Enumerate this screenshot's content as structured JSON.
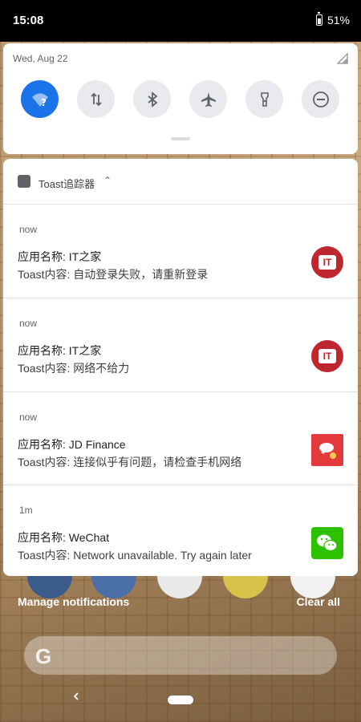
{
  "status_bar": {
    "time": "15:08",
    "battery": "51%"
  },
  "quick_settings": {
    "date": "Wed, Aug 22",
    "tiles": [
      {
        "name": "wifi",
        "icon": "wifi-icon",
        "active": true
      },
      {
        "name": "data",
        "icon": "data-transfer-icon",
        "active": false
      },
      {
        "name": "bluetooth",
        "icon": "bluetooth-icon",
        "active": false
      },
      {
        "name": "airplane",
        "icon": "airplane-icon",
        "active": false
      },
      {
        "name": "flashlight",
        "icon": "flashlight-icon",
        "active": false
      },
      {
        "name": "dnd",
        "icon": "do-not-disturb-icon",
        "active": false
      }
    ]
  },
  "notifications": {
    "group_title": "Toast追踪器",
    "items": [
      {
        "time": "now",
        "title": "应用名称: IT之家",
        "text": "Toast内容: 自动登录失败，请重新登录",
        "icon": "ithome-icon",
        "icon_label": "IT"
      },
      {
        "time": "now",
        "title": "应用名称: IT之家",
        "text": "Toast内容: 网络不给力",
        "icon": "ithome-icon",
        "icon_label": "IT"
      },
      {
        "time": "now",
        "title": "应用名称: JD Finance",
        "text": "Toast内容: 连接似乎有问题，请检查手机网络",
        "icon": "jd-finance-icon",
        "icon_label": ""
      },
      {
        "time": "1m",
        "title": "应用名称: WeChat",
        "text": "Toast内容: Network unavailable. Try again later",
        "icon": "wechat-icon",
        "icon_label": ""
      }
    ]
  },
  "actions": {
    "manage": "Manage notifications",
    "clear": "Clear all"
  },
  "search": {
    "logo": "G"
  },
  "colors": {
    "accent": "#1a73e8",
    "ithome": "#c0262d",
    "jd": "#e4393c",
    "wechat": "#2dc100"
  }
}
